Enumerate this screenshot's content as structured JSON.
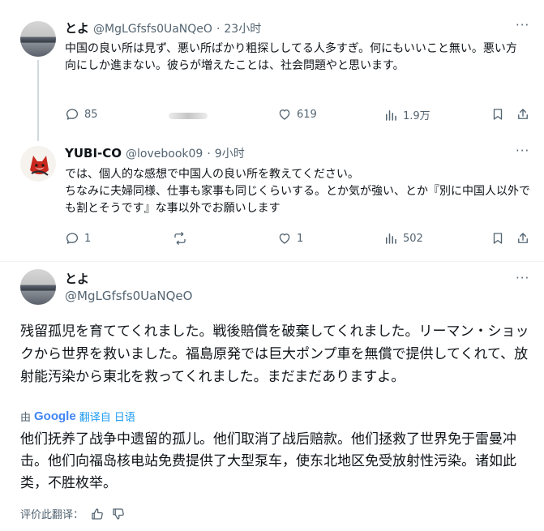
{
  "tweet1": {
    "name": "とよ",
    "handle": "@MgLGfsfs0UaNQeO",
    "sep": "·",
    "time": "23小时",
    "text": "中国の良い所は見ず、悪い所ばかり粗探ししてる人多すぎ。何にもいいこと無い。悪い方向にしか進まない。彼らが増えたことは、社会問題やと思います。",
    "replies": "85",
    "likes": "619",
    "views": "1.9万"
  },
  "tweet2": {
    "name": "YUBI-CO",
    "handle": "@lovebook09",
    "sep": "·",
    "time": "9小时",
    "text": "では、個人的な感想で中国人の良い所を教えてください。\nちなみに夫婦同様、仕事も家事も同じくらいする。とか気が強い、とか『別に中国人以外でも割とそうです』な事以外でお願いします",
    "replies": "1",
    "likes": "1",
    "views": "502"
  },
  "tweet3": {
    "name": "とよ",
    "handle": "@MgLGfsfs0UaNQeO",
    "text": "残留孤児を育ててくれました。戦後賠償を破棄してくれました。リーマン・ショックから世界を救いました。福島原発では巨大ポンプ車を無償で提供してくれて、放射能汚染から東北を救ってくれました。まだまだありますよ。",
    "translate_by": "由",
    "translate_google": "Google",
    "translate_link": "翻译自 日语",
    "translation": "他们抚养了战争中遗留的孤儿。他们取消了战后赔款。他们拯救了世界免于雷曼冲击。他们向福岛核电站免费提供了大型泵车，使东北地区免受放射性污染。诸如此类，不胜枚举。",
    "rate_label": "评价此翻译："
  },
  "more_label": "···",
  "colors": {
    "text": "#0f1419",
    "secondary": "#536471",
    "link": "#1d9bf0",
    "line": "#cfd9de"
  }
}
